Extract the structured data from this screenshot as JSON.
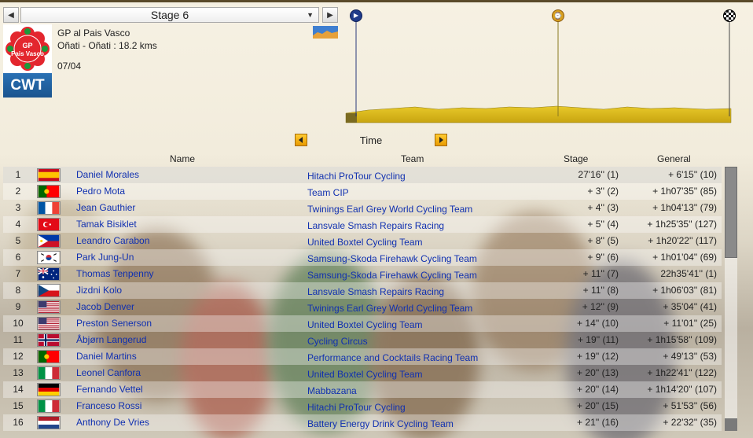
{
  "stage": {
    "prev_icon": "chevron-left-icon",
    "label": "Stage 6",
    "next_icon": "chevron-right-icon"
  },
  "race": {
    "logo_text": "GP\nPais Vasco",
    "series_badge": "CWT",
    "name": "GP al Pais Vasco",
    "route": "Oñati - Oñati : 18.2 kms",
    "date": "07/04",
    "stage_type_icon": "time-trial-terrain-icon"
  },
  "profile": {
    "markers": [
      "start-flag-icon",
      "intermediate-time-icon",
      "finish-flag-icon"
    ]
  },
  "tab": {
    "label": "Time"
  },
  "columns": {
    "name": "Name",
    "team": "Team",
    "stage": "Stage",
    "general": "General"
  },
  "rows": [
    {
      "pos": "1",
      "flag": "es",
      "name": "Daniel Morales",
      "team": "Hitachi ProTour Cycling",
      "stage": "27'16'' (1)",
      "general": "+ 6'15'' (10)"
    },
    {
      "pos": "2",
      "flag": "pt",
      "name": "Pedro Mota",
      "team": "Team CIP",
      "stage": "+ 3'' (2)",
      "general": "+ 1h07'35'' (85)"
    },
    {
      "pos": "3",
      "flag": "fr",
      "name": "Jean Gauthier",
      "team": "Twinings Earl Grey World Cycling Team",
      "stage": "+ 4'' (3)",
      "general": "+ 1h04'13'' (79)"
    },
    {
      "pos": "4",
      "flag": "tr",
      "name": "Tamak Bisiklet",
      "team": "Lansvale Smash Repairs Racing",
      "stage": "+ 5'' (4)",
      "general": "+ 1h25'35'' (127)"
    },
    {
      "pos": "5",
      "flag": "ph",
      "name": "Leandro Carabon",
      "team": "United Boxtel Cycling Team",
      "stage": "+ 8'' (5)",
      "general": "+ 1h20'22'' (117)"
    },
    {
      "pos": "6",
      "flag": "kr",
      "name": "Park Jung-Un",
      "team": "Samsung-Skoda Firehawk Cycling Team",
      "stage": "+ 9'' (6)",
      "general": "+ 1h01'04'' (69)"
    },
    {
      "pos": "7",
      "flag": "au",
      "name": "Thomas Tenpenny",
      "team": "Samsung-Skoda Firehawk Cycling Team",
      "stage": "+ 11'' (7)",
      "general": "22h35'41'' (1)"
    },
    {
      "pos": "8",
      "flag": "cz",
      "name": "Jizdni Kolo",
      "team": "Lansvale Smash Repairs Racing",
      "stage": "+ 11'' (8)",
      "general": "+ 1h06'03'' (81)"
    },
    {
      "pos": "9",
      "flag": "us",
      "name": "Jacob Denver",
      "team": "Twinings Earl Grey World Cycling Team",
      "stage": "+ 12'' (9)",
      "general": "+ 35'04'' (41)"
    },
    {
      "pos": "10",
      "flag": "us",
      "name": "Preston Senerson",
      "team": "United Boxtel Cycling Team",
      "stage": "+ 14'' (10)",
      "general": "+ 11'01'' (25)"
    },
    {
      "pos": "11",
      "flag": "no",
      "name": "Åbjørn Langerud",
      "team": "Cycling Circus",
      "stage": "+ 19'' (11)",
      "general": "+ 1h15'58'' (109)"
    },
    {
      "pos": "12",
      "flag": "pt",
      "name": "Daniel Martins",
      "team": "Performance and Cocktails Racing Team",
      "stage": "+ 19'' (12)",
      "general": "+ 49'13'' (53)"
    },
    {
      "pos": "13",
      "flag": "it",
      "name": "Leonel Canfora",
      "team": "United Boxtel Cycling Team",
      "stage": "+ 20'' (13)",
      "general": "+ 1h22'41'' (122)"
    },
    {
      "pos": "14",
      "flag": "de",
      "name": "Fernando Vettel",
      "team": "Mabbazana",
      "stage": "+ 20'' (14)",
      "general": "+ 1h14'20'' (107)"
    },
    {
      "pos": "15",
      "flag": "it",
      "name": "Franceso Rossi",
      "team": "Hitachi ProTour Cycling",
      "stage": "+ 20'' (15)",
      "general": "+ 51'53'' (56)"
    },
    {
      "pos": "16",
      "flag": "nl",
      "name": "Anthony De Vries",
      "team": "Battery Energy Drink Cycling Team",
      "stage": "+ 21'' (16)",
      "general": "+ 22'32'' (35)"
    }
  ]
}
